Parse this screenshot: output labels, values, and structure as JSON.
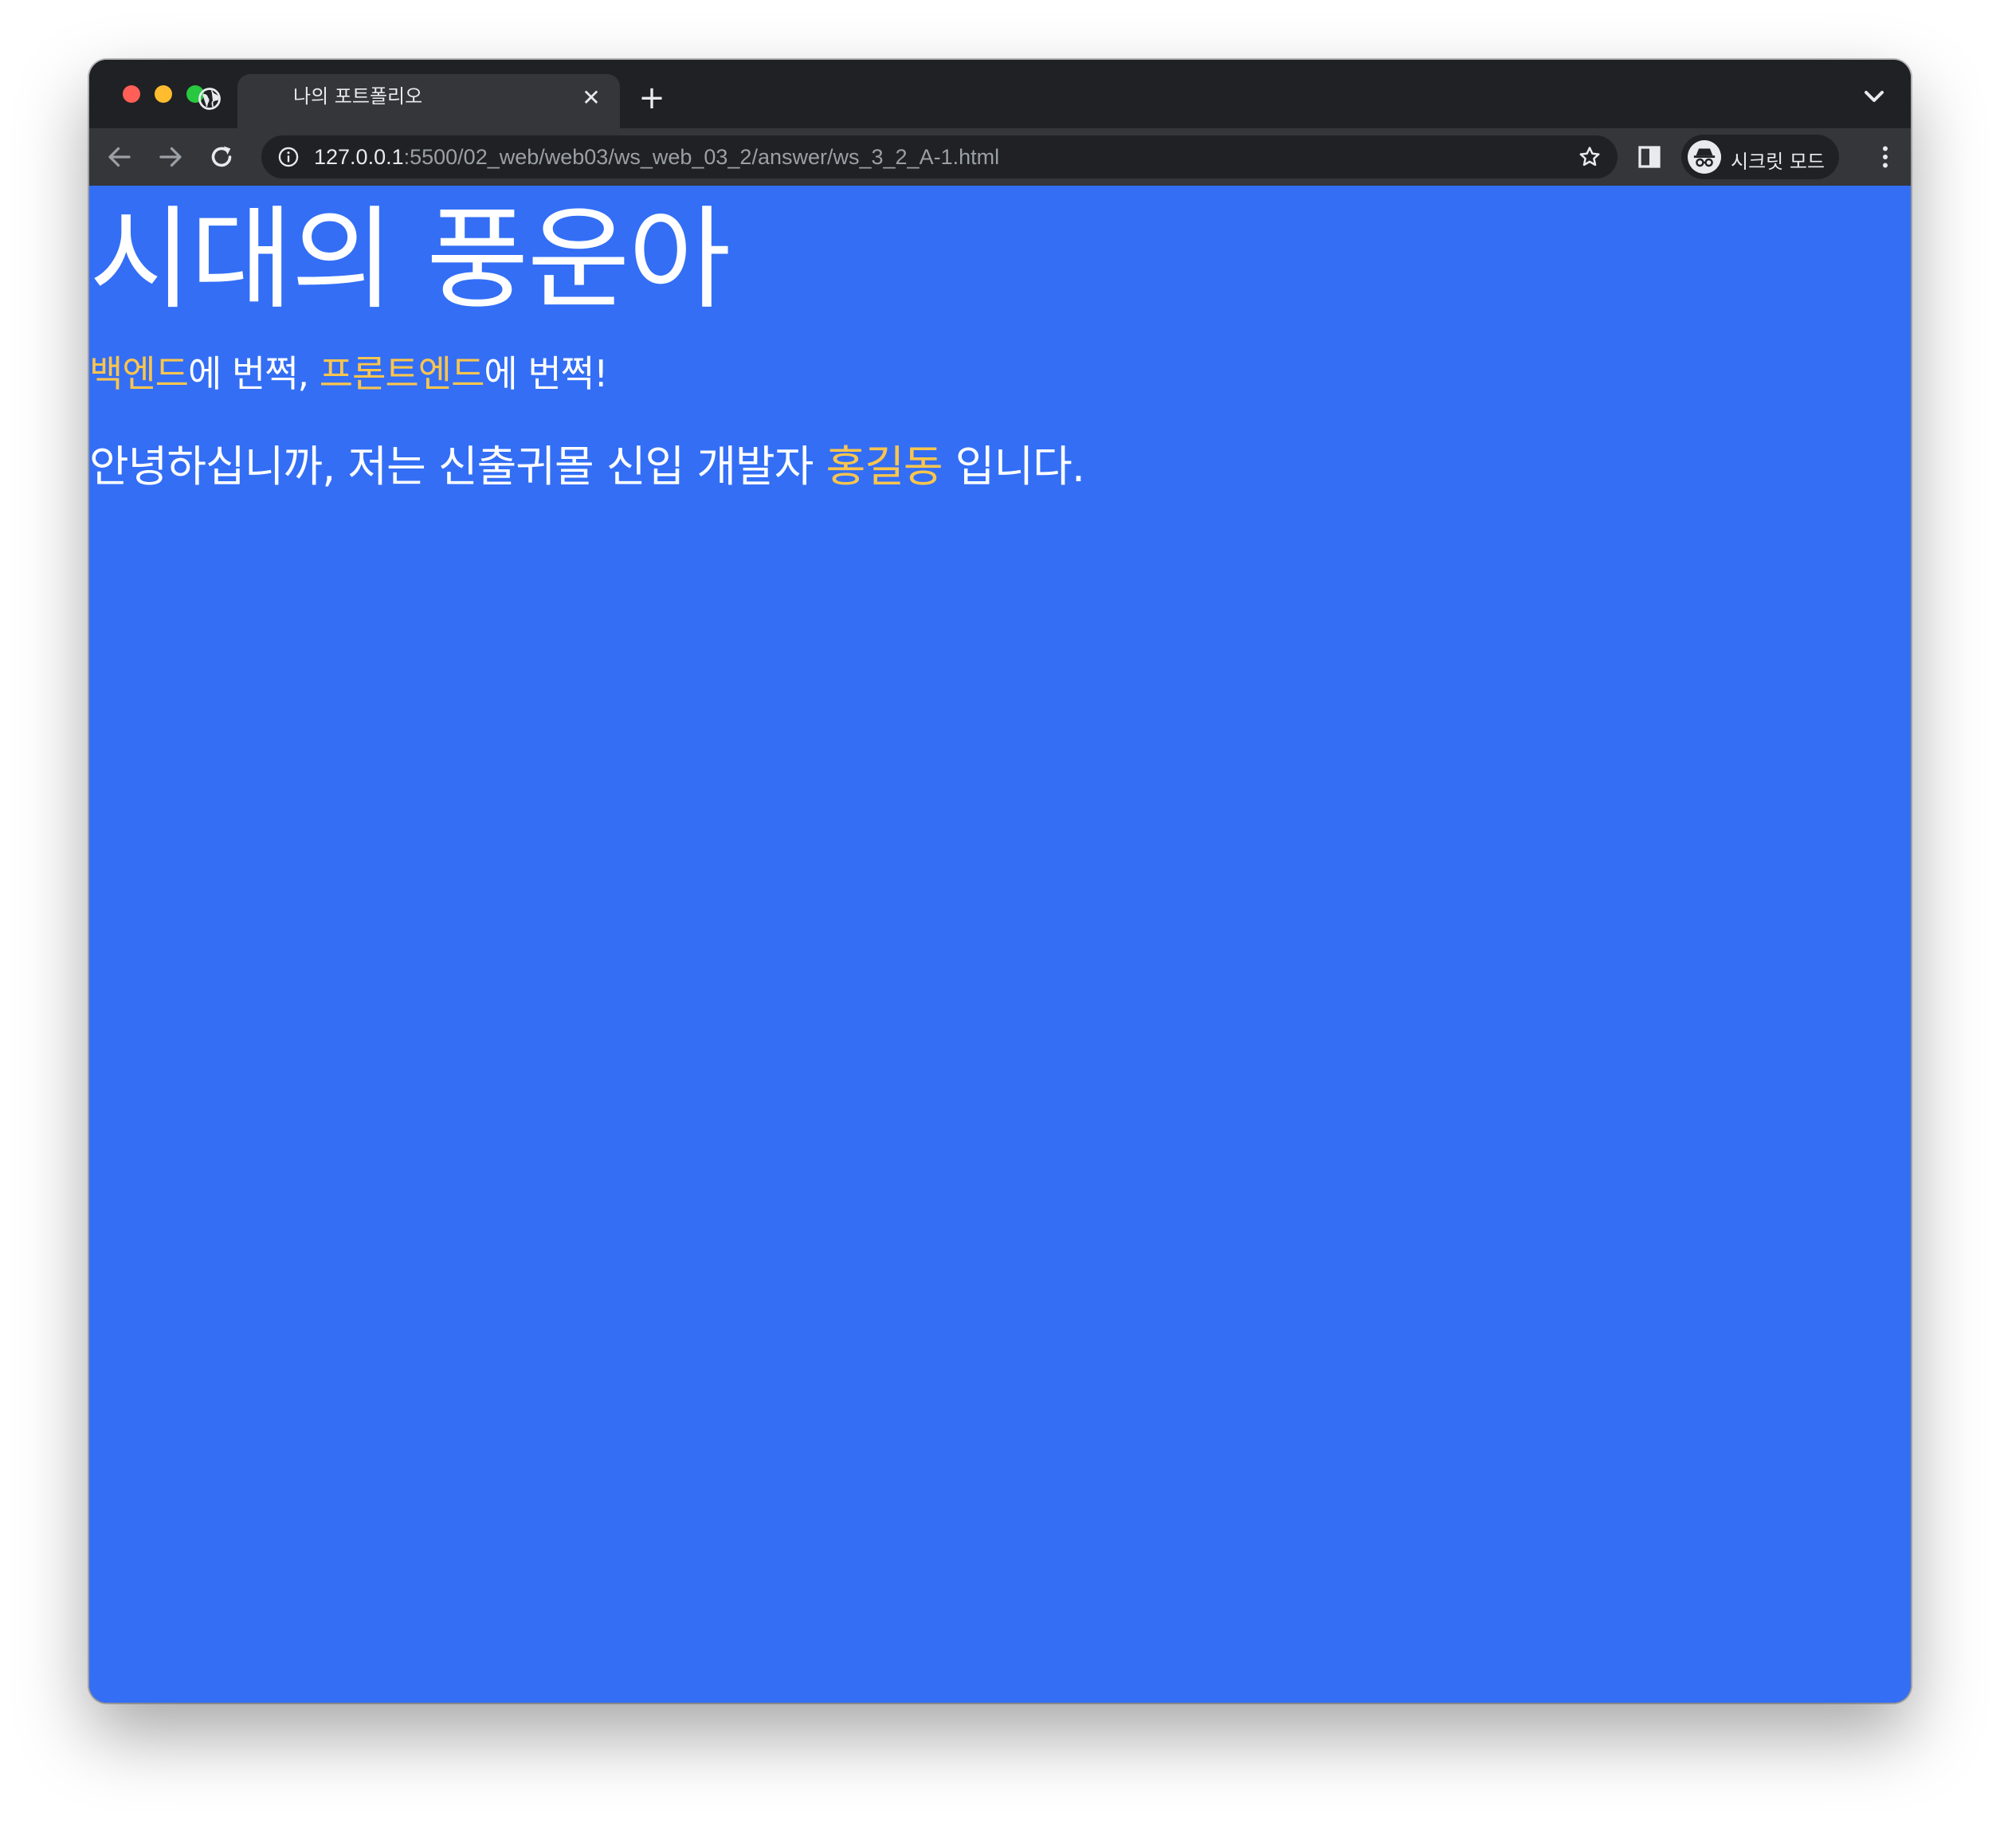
{
  "browser": {
    "tab": {
      "title": "나의 포트폴리오",
      "close_symbol": "✕",
      "favicon": "globe-icon"
    },
    "new_tab_symbol": "+",
    "url": {
      "host": "127.0.0.1",
      "path": ":5500/02_web/web03/ws_web_03_2/answer/ws_3_2_A-1.html"
    },
    "incognito_label": "시크릿 모드"
  },
  "page": {
    "heading": "시대의 풍운아",
    "tagline": {
      "part1": "백엔드",
      "part2": "에 번쩍, ",
      "part3": "프론트엔드",
      "part4": "에 번쩍!"
    },
    "intro": {
      "part1": "안녕하십니까, 저는 신출귀몰 신입 개발자 ",
      "name": "홍길동",
      "part2": " 입니다."
    }
  },
  "colors": {
    "page_background": "#336ef5",
    "accent": "#fbc54d",
    "text": "#ffffff"
  }
}
